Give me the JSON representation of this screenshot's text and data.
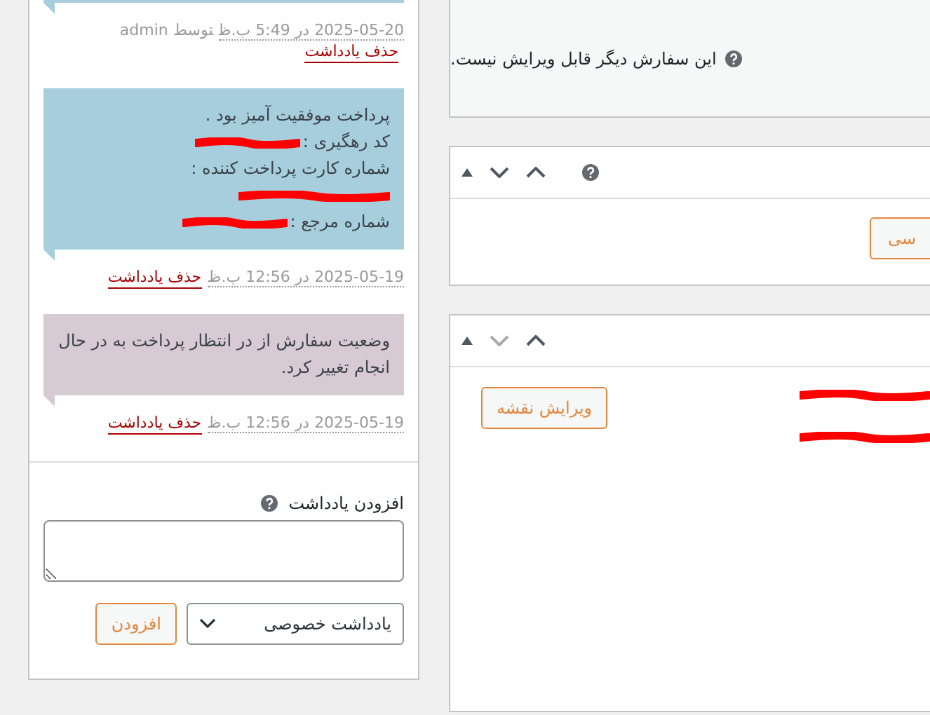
{
  "order_notes": {
    "notes": [
      {
        "color": "#a7cedc",
        "date": "2025-05-20 در 5:49 ب.ظ",
        "author": "توسط admin",
        "delete_link": "حذف یادداشت"
      },
      {
        "color": "#a7cedc",
        "lines": [
          {
            "text": "پرداخت موفقیت آمیز بود .",
            "redacted": false
          },
          {
            "text": "کد رهگیری :",
            "redacted": true
          },
          {
            "text": "شماره کارت پرداخت کننده :",
            "redacted": false
          },
          {
            "redacted": true
          },
          {
            "text": "شماره مرجع :",
            "redacted": true
          }
        ],
        "date": "2025-05-19 در 12:56 ب.ظ",
        "delete_link": "حذف یادداشت"
      },
      {
        "color": "#d7cad2",
        "lines": [
          {
            "text": "وضعیت سفارش از در انتظار پرداخت به در حال انجام تغییر کرد.",
            "redacted": false
          }
        ],
        "date": "2025-05-19 در 12:56 ب.ظ",
        "delete_link": "حذف یادداشت"
      }
    ],
    "add_note": {
      "label": "افزودن یادداشت",
      "note_type": "یادداشت خصوصی",
      "button": "افزودن"
    }
  },
  "notice": {
    "text": "این سفارش دیگر قابل ویرایش نیست."
  },
  "panels": [
    {
      "handles": [
        {
          "kind": "move"
        },
        {
          "kind": "down",
          "disabled": false
        },
        {
          "kind": "up"
        },
        {
          "kind": "help"
        }
      ],
      "button": "سی"
    },
    {
      "handles": [
        {
          "kind": "move"
        },
        {
          "kind": "down",
          "disabled": true
        },
        {
          "kind": "up"
        }
      ],
      "button": "ویرایش نقشه",
      "lines": [
        {
          "redacted": true
        },
        {
          "redacted": true
        }
      ]
    }
  ]
}
